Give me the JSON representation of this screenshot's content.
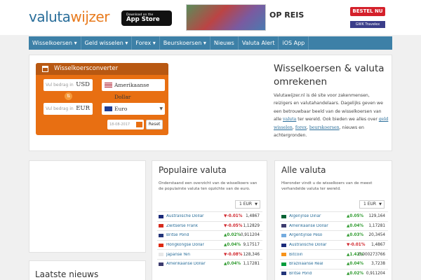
{
  "header": {
    "logo_part1": "valuta",
    "logo_part2": "wijzer",
    "appstore_small": "Download on the",
    "appstore_big": "App Store",
    "banner_text": "OP REIS",
    "bestel": "BESTEL NU",
    "gwk": "GWK Travelex"
  },
  "nav": [
    {
      "label": "Wisselkoersen ▾"
    },
    {
      "label": "Geld wisselen ▾"
    },
    {
      "label": "Forex ▾"
    },
    {
      "label": "Beurskoersen ▾"
    },
    {
      "label": "Nieuws"
    },
    {
      "label": "Valuta Alert"
    },
    {
      "label": "iOS App"
    }
  ],
  "converter": {
    "title": "Wisselkoersconverter",
    "amount_placeholder_1": "Vul bedrag in",
    "currency_1": "USD",
    "select_1": "Amerikaanse Dollar",
    "amount_placeholder_2": "Vul bedrag in",
    "currency_2": "EUR",
    "select_2": "Euro",
    "date": "18-08-2017",
    "reset": "Reset"
  },
  "intro": {
    "title": "Wisselkoersen & valuta omrekenen",
    "text_1": "Valutawijzer.nl is dé site voor zakenmensen, reizigers en valutahandelaars. Dagelijks geven we een betrouwbaar beeld van de wisselkoersen van alle ",
    "link_valuta": "valuta",
    "text_2": " ter wereld. Ook bieden we alles over ",
    "link_geld": "geld wisselen",
    "text_3": ", ",
    "link_forex": "forex",
    "text_4": ", ",
    "link_beurs": "beurskoersen",
    "text_5": ", nieuws en achtergronden."
  },
  "popular": {
    "title": "Populaire valuta",
    "subtitle": "Onderstaand een overzicht van de wisselkoers van de populairste valuta ten opzichte van de euro.",
    "selector": "1 EUR",
    "rows": [
      {
        "name": "Australische Dollar",
        "change": "▼-0.01%",
        "dir": "down",
        "value": "1,4867",
        "flag": "#1a2a7a"
      },
      {
        "name": "Zwitserse Frank",
        "change": "▼-0.05%",
        "dir": "down",
        "value": "1,12829",
        "flag": "#d52b1e"
      },
      {
        "name": "Britse Pond",
        "change": "▲0.02%",
        "dir": "up",
        "value": "0,911204",
        "flag": "#23357a"
      },
      {
        "name": "Hongkongse Dollar",
        "change": "▲0.04%",
        "dir": "up",
        "value": "9,17517",
        "flag": "#de2910"
      },
      {
        "name": "Japanse Yen",
        "change": "▼-0.08%",
        "dir": "down",
        "value": "128,346",
        "flag": "#e8e8e8"
      },
      {
        "name": "Amerikaanse Dollar",
        "change": "▲0.04%",
        "dir": "up",
        "value": "1,17281",
        "flag": "#3c3b6e"
      }
    ]
  },
  "all": {
    "title": "Alle valuta",
    "subtitle": "Hieronder vindt u de wisselkoers van de meest verhandelde valuta ter wereld.",
    "selector": "1 EUR",
    "rows": [
      {
        "name": "Algerijnse Dinar",
        "change": "▲0.05%",
        "dir": "up",
        "value": "129,164",
        "flag": "#006233"
      },
      {
        "name": "Amerikaanse Dollar",
        "change": "▲0.04%",
        "dir": "up",
        "value": "1,17281",
        "flag": "#3c3b6e"
      },
      {
        "name": "Argentijnse Peso",
        "change": "▲0.03%",
        "dir": "up",
        "value": "20,3454",
        "flag": "#74acdf"
      },
      {
        "name": "Australische Dollar",
        "change": "▼-0.01%",
        "dir": "down",
        "value": "1,4867",
        "flag": "#1a2a7a"
      },
      {
        "name": "Bitcoin",
        "change": "▲1.42%",
        "dir": "up",
        "value": "0,000273766",
        "flag": "#f7931a"
      },
      {
        "name": "Braziliaanse Real",
        "change": "▲0.04%",
        "dir": "up",
        "value": "3,7238",
        "flag": "#009c3b"
      },
      {
        "name": "Britse Pond",
        "change": "▲0.02%",
        "dir": "up",
        "value": "0,911204",
        "flag": "#23357a"
      }
    ]
  },
  "news": {
    "title": "Laatste nieuws"
  }
}
